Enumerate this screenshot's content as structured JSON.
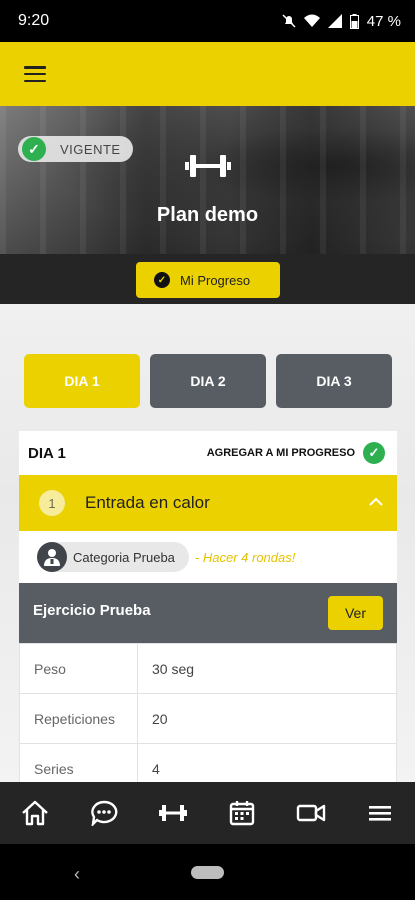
{
  "status_bar": {
    "time": "9:20",
    "battery": "47 %"
  },
  "header": {
    "menu_icon": "hamburger-icon"
  },
  "hero": {
    "status_badge": "VIGENTE",
    "icon": "dumbbell-icon",
    "plan_title": "Plan demo"
  },
  "progress_button": {
    "label": "Mi Progreso",
    "icon": "check-circle-icon"
  },
  "day_tabs": [
    {
      "label": "DIA 1",
      "active": true
    },
    {
      "label": "DIA 2",
      "active": false
    },
    {
      "label": "DIA 3",
      "active": false
    }
  ],
  "day_card": {
    "title": "DIA 1",
    "add_to_progress": "AGREGAR A MI PROGRESO",
    "section": {
      "number": "1",
      "title": "Entrada en calor",
      "category": "Categoria Prueba",
      "note": "Hacer 4 rondas!"
    },
    "exercise": {
      "name": "Ejercicio Prueba",
      "view_button": "Ver",
      "rows": [
        {
          "label": "Peso",
          "value": "30 seg"
        },
        {
          "label": "Repeticiones",
          "value": "20"
        },
        {
          "label": "Series",
          "value": "4"
        }
      ]
    }
  },
  "bottom_nav": [
    "home-icon",
    "chat-icon",
    "dumbbell-icon",
    "calendar-icon",
    "video-icon",
    "menu-icon"
  ],
  "colors": {
    "accent": "#ecd100",
    "dark": "#252525",
    "tab_inactive": "#575d63",
    "success": "#2fb050"
  }
}
